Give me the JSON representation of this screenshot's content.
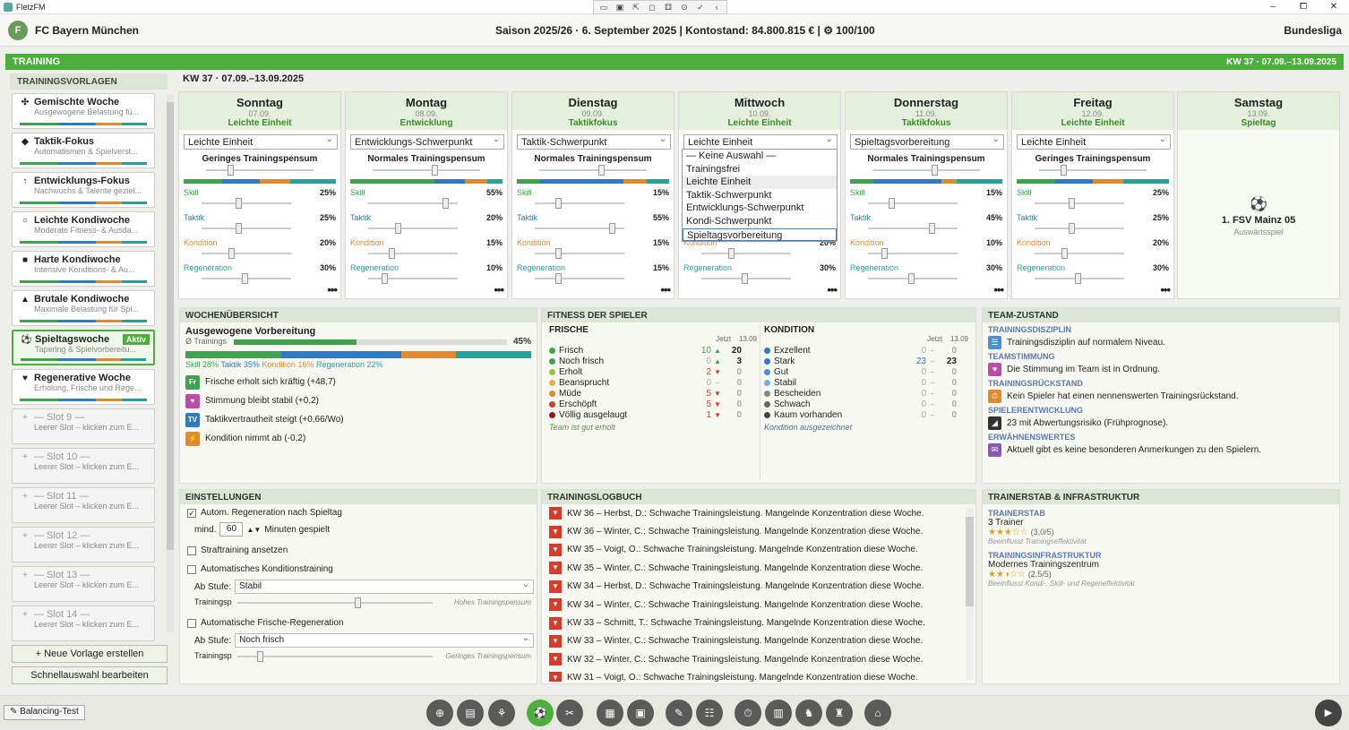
{
  "app": {
    "title": "FletzFM",
    "minimize": "–",
    "maximize": "⧠",
    "close": "✕",
    "toolbar": [
      "▭",
      "▣",
      "⇱",
      "◻",
      "⚃",
      "⊙",
      "✓",
      "‹"
    ]
  },
  "header": {
    "club_initial": "F",
    "club": "FC Bayern München",
    "season": "Saison 2025/26  ·  6. September 2025  |  Kontostand: 84.800.815 €  |  ⚙ 100/100",
    "league": "Bundesliga"
  },
  "training": {
    "title": "TRAINING",
    "week_right": "KW 37  ·  07.09.–13.09.2025",
    "week_head": "KW 37  ·  07.09.–13.09.2025"
  },
  "colors": {
    "skill": "#3fa34d",
    "taktik": "#2e7bc4",
    "kondition": "#e08a2e",
    "regeneration": "#2aa198",
    "accent": "#4caf3c"
  },
  "sidebar": {
    "title": "TRAININGSVORLAGEN",
    "templates": [
      {
        "icon": "✣",
        "name": "Gemischte Woche",
        "sub": "Ausgewogene Belastung fü..."
      },
      {
        "icon": "◆",
        "name": "Taktik-Fokus",
        "sub": "Automatismen & Spielverst..."
      },
      {
        "icon": "↑",
        "name": "Entwicklungs-Fokus",
        "sub": "Nachwuchs & Talente geziel..."
      },
      {
        "icon": "○",
        "name": "Leichte Kondiwoche",
        "sub": "Moderate Fitness- & Ausda..."
      },
      {
        "icon": "■",
        "name": "Harte Kondiwoche",
        "sub": "Intensive Konditions- & Au..."
      },
      {
        "icon": "▲",
        "name": "Brutale Kondiwoche",
        "sub": "Maximale Belastung für Spi..."
      },
      {
        "icon": "⚽",
        "name": "Spieltagswoche",
        "sub": "Tapering & Spielvorbereitu...",
        "badge": "Aktiv"
      },
      {
        "icon": "♥",
        "name": "Regenerative Woche",
        "sub": "Erholung, Frische und Rege..."
      },
      {
        "icon": "+",
        "name": "— Slot 9 —",
        "sub": "Leerer Slot – klicken zum E..."
      },
      {
        "icon": "+",
        "name": "— Slot 10 —",
        "sub": "Leerer Slot – klicken zum E..."
      },
      {
        "icon": "+",
        "name": "— Slot 11 —",
        "sub": "Leerer Slot – klicken zum E..."
      },
      {
        "icon": "+",
        "name": "— Slot 12 —",
        "sub": "Leerer Slot – klicken zum E..."
      },
      {
        "icon": "+",
        "name": "— Slot 13 —",
        "sub": "Leerer Slot – klicken zum E..."
      },
      {
        "icon": "+",
        "name": "— Slot 14 —",
        "sub": "Leerer Slot – klicken zum E..."
      }
    ],
    "new_btn": "+ Neue Vorlage erstellen",
    "quick_btn": "Schnellauswahl bearbeiten"
  },
  "days": [
    {
      "name": "Sonntag",
      "date": "07.09.",
      "type": "Leichte Einheit",
      "select": "Leichte Einheit",
      "pensum": "Geringes Trainingspensum",
      "skill": "25%",
      "taktik": "25%",
      "kondition": "20%",
      "regen": "30%"
    },
    {
      "name": "Montag",
      "date": "08.09.",
      "type": "Entwicklung",
      "select": "Entwicklungs-Schwerpunkt",
      "pensum": "Normales Trainingspensum",
      "skill": "55%",
      "taktik": "20%",
      "kondition": "15%",
      "regen": "10%"
    },
    {
      "name": "Dienstag",
      "date": "09.09.",
      "type": "Taktikfokus",
      "select": "Taktik-Schwerpunkt",
      "pensum": "Normales Trainingspensum",
      "skill": "15%",
      "taktik": "55%",
      "kondition": "15%",
      "regen": "15%"
    },
    {
      "name": "Mittwoch",
      "date": "10.09.",
      "type": "Leichte Einheit",
      "select": "Leichte Einheit",
      "pensum": "Geringes Trainingspensum",
      "skill": "25%",
      "taktik": "25%",
      "kondition": "20%",
      "regen": "30%"
    },
    {
      "name": "Donnerstag",
      "date": "11.09.",
      "type": "Taktikfokus",
      "select": "Spieltagsvorbereitung",
      "pensum": "Normales Trainingspensum",
      "skill": "15%",
      "taktik": "45%",
      "kondition": "10%",
      "regen": "30%"
    },
    {
      "name": "Freitag",
      "date": "12.09.",
      "type": "Leichte Einheit",
      "select": "Leichte Einheit",
      "pensum": "Geringes Trainingspensum",
      "skill": "25%",
      "taktik": "25%",
      "kondition": "20%",
      "regen": "30%"
    }
  ],
  "labels": {
    "skill": "Skill",
    "taktik": "Taktik",
    "kondition": "Kondition",
    "regen": "Regeneration",
    "more": "•••"
  },
  "saturday": {
    "name": "Samstag",
    "date": "13.09.",
    "type": "Spieltag",
    "ball_icon": "⚽",
    "opponent": "1. FSV Mainz 05",
    "venue": "Auswärtsspiel"
  },
  "dropdown": [
    "— Keine Auswahl —",
    "Trainingsfrei",
    "Leichte Einheit",
    "Taktik-Schwerpunkt",
    "Entwicklungs-Schwerpunkt",
    "Kondi-Schwerpunkt",
    "Spieltagsvorbereitung"
  ],
  "overview": {
    "title": "WOCHENÜBERSICHT",
    "subtitle": "Ausgewogene Vorbereitung",
    "avg_label": "Ø Trainings",
    "avg_value": "45%",
    "avg_fraction": 0.45,
    "split": {
      "skill": "Skill 28%",
      "taktik": "Taktik 35%",
      "kondition": "Kondition 16%",
      "regen": "Regeneration 22%"
    },
    "effects": [
      {
        "code": "Fr",
        "color": "#3fa34d",
        "text": "Frische erholt sich kräftig (+48,7)"
      },
      {
        "code": "♥",
        "color": "#c04aa8",
        "text": "Stimmung bleibt stabil (+0,2)"
      },
      {
        "code": "TV",
        "color": "#2e7bc4",
        "text": "Taktikvertrautheit steigt (+0,66/Wo)"
      },
      {
        "code": "⚡",
        "color": "#e08a2e",
        "text": "Kondition nimmt ab (-0,2)"
      }
    ]
  },
  "fitness": {
    "title": "FITNESS DER SPIELER",
    "frische_title": "FRISCHE",
    "kond_title": "KONDITION",
    "now": "Jetzt",
    "date": "13.09",
    "frische": [
      {
        "l": "Frisch",
        "c": "#3fa34d",
        "a": "10",
        "ar": "▲",
        "b": "20"
      },
      {
        "l": "Noch frisch",
        "c": "#3fa34d",
        "a": "0",
        "ar": "▲",
        "b": "3"
      },
      {
        "l": "Erholt",
        "c": "#9bc43a",
        "a": "2",
        "ar": "▼",
        "b": "0"
      },
      {
        "l": "Beansprucht",
        "c": "#e0b03a",
        "a": "0",
        "ar": "–",
        "b": "0"
      },
      {
        "l": "Müde",
        "c": "#e08a2e",
        "a": "5",
        "ar": "▼",
        "b": "0"
      },
      {
        "l": "Erschöpft",
        "c": "#d93a2a",
        "a": "5",
        "ar": "▼",
        "b": "0"
      },
      {
        "l": "Völlig ausgelaugt",
        "c": "#a01818",
        "a": "1",
        "ar": "▼",
        "b": "0"
      }
    ],
    "kondition": [
      {
        "l": "Exzellent",
        "c": "#2e7bc4",
        "a": "0",
        "ar": "–",
        "b": "0"
      },
      {
        "l": "Stark",
        "c": "#2e7bc4",
        "a": "23",
        "ar": "–",
        "b": "23"
      },
      {
        "l": "Gut",
        "c": "#4a8fd4",
        "a": "0",
        "ar": "–",
        "b": "0"
      },
      {
        "l": "Stabil",
        "c": "#7aaed8",
        "a": "0",
        "ar": "–",
        "b": "0"
      },
      {
        "l": "Bescheiden",
        "c": "#888",
        "a": "0",
        "ar": "–",
        "b": "0"
      },
      {
        "l": "Schwach",
        "c": "#666",
        "a": "0",
        "ar": "–",
        "b": "0"
      },
      {
        "l": "Kaum vorhanden",
        "c": "#444",
        "a": "0",
        "ar": "–",
        "b": "0"
      }
    ],
    "frische_note": "Team ist gut erholt",
    "kond_note": "Kondition ausgezeichnet"
  },
  "team": {
    "title": "TEAM-ZUSTAND",
    "items": [
      {
        "t": "TRAININGSDISZIPLIN",
        "ic": "☰",
        "c": "#4a8fd4",
        "txt": "Trainingsdisziplin auf normalem Niveau."
      },
      {
        "t": "TEAMSTIMMUNG",
        "ic": "♥",
        "c": "#c04aa8",
        "txt": "Die Stimmung im Team ist in Ordnung."
      },
      {
        "t": "TRAININGSRÜCKSTAND",
        "ic": "⏱",
        "c": "#e08a2e",
        "txt": "Kein Spieler hat einen nennenswerten Trainingsrückstand."
      },
      {
        "t": "SPIELERENTWICKLUNG",
        "ic": "◢",
        "c": "#333",
        "txt": "23 mit Abwertungsrisiko (Frühprognose)."
      },
      {
        "t": "ERWÄHNENSWERTES",
        "ic": "✉",
        "c": "#8a5ab0",
        "txt": "Aktuell gibt es keine besonderen Anmerkungen zu den Spielern."
      }
    ]
  },
  "settings": {
    "title": "EINSTELLUNGEN",
    "auto_regen": "Autom. Regeneration nach Spieltag",
    "mind": "mind.",
    "minutes": "60",
    "minutes_suffix": "Minuten gespielt",
    "straf": "Straftraining ansetzen",
    "auto_kondi": "Automatisches Konditionstraining",
    "ab_stufe": "Ab Stufe:",
    "stufe1": "Stabil",
    "trainingsp": "Trainingsp",
    "hohes": "Hohes Trainingspensum",
    "auto_frische": "Automatische Frische-Regeneration",
    "stufe2": "Noch frisch",
    "geringes": "Geringes Trainingspensum"
  },
  "logbook": {
    "title": "TRAININGSLOGBUCH",
    "entries": [
      "KW 36 – Herbst, D.: Schwache Trainingsleistung. Mangelnde Konzentration diese Woche.",
      "KW 36 – Winter, C.: Schwache Trainingsleistung. Mangelnde Konzentration diese Woche.",
      "KW 35 – Voigt, O.: Schwache Trainingsleistung. Mangelnde Konzentration diese Woche.",
      "KW 35 – Winter, C.: Schwache Trainingsleistung. Mangelnde Konzentration diese Woche.",
      "KW 34 – Herbst, D.: Schwache Trainingsleistung. Mangelnde Konzentration diese Woche.",
      "KW 34 – Winter, C.: Schwache Trainingsleistung. Mangelnde Konzentration diese Woche.",
      "KW 33 – Schmitt, T.: Schwache Trainingsleistung. Mangelnde Konzentration diese Woche.",
      "KW 33 – Winter, C.: Schwache Trainingsleistung. Mangelnde Konzentration diese Woche.",
      "KW 32 – Winter, C.: Schwache Trainingsleistung. Mangelnde Konzentration diese Woche.",
      "KW 31 – Voigt, O.: Schwache Trainingsleistung. Mangelnde Konzentration diese Woche."
    ]
  },
  "staff": {
    "title": "TRAINERSTAB & INFRASTRUKTUR",
    "t1": "TRAINERSTAB",
    "v1": "3 Trainer",
    "r1": "★★★☆☆",
    "s1": "(3,0/5)",
    "n1": "Beeinflusst Trainingseffektivität",
    "t2": "TRAININGSINFRASTRUKTUR",
    "v2": "Modernes Trainingszentrum",
    "r2": "★★◑☆☆",
    "s2": "(2,5/5)",
    "n2": "Beeinflusst Kondi-, Skill- und Regeneffektivität"
  },
  "bottom": {
    "test": "✎ Balancing-Test",
    "play": "▶",
    "nav": [
      "⊕",
      "▤",
      "⚘",
      "⚽",
      "✂",
      "▦",
      "▣",
      "✎",
      "☷",
      "⏱",
      "▥",
      "♞",
      "♜",
      "⌂"
    ]
  }
}
